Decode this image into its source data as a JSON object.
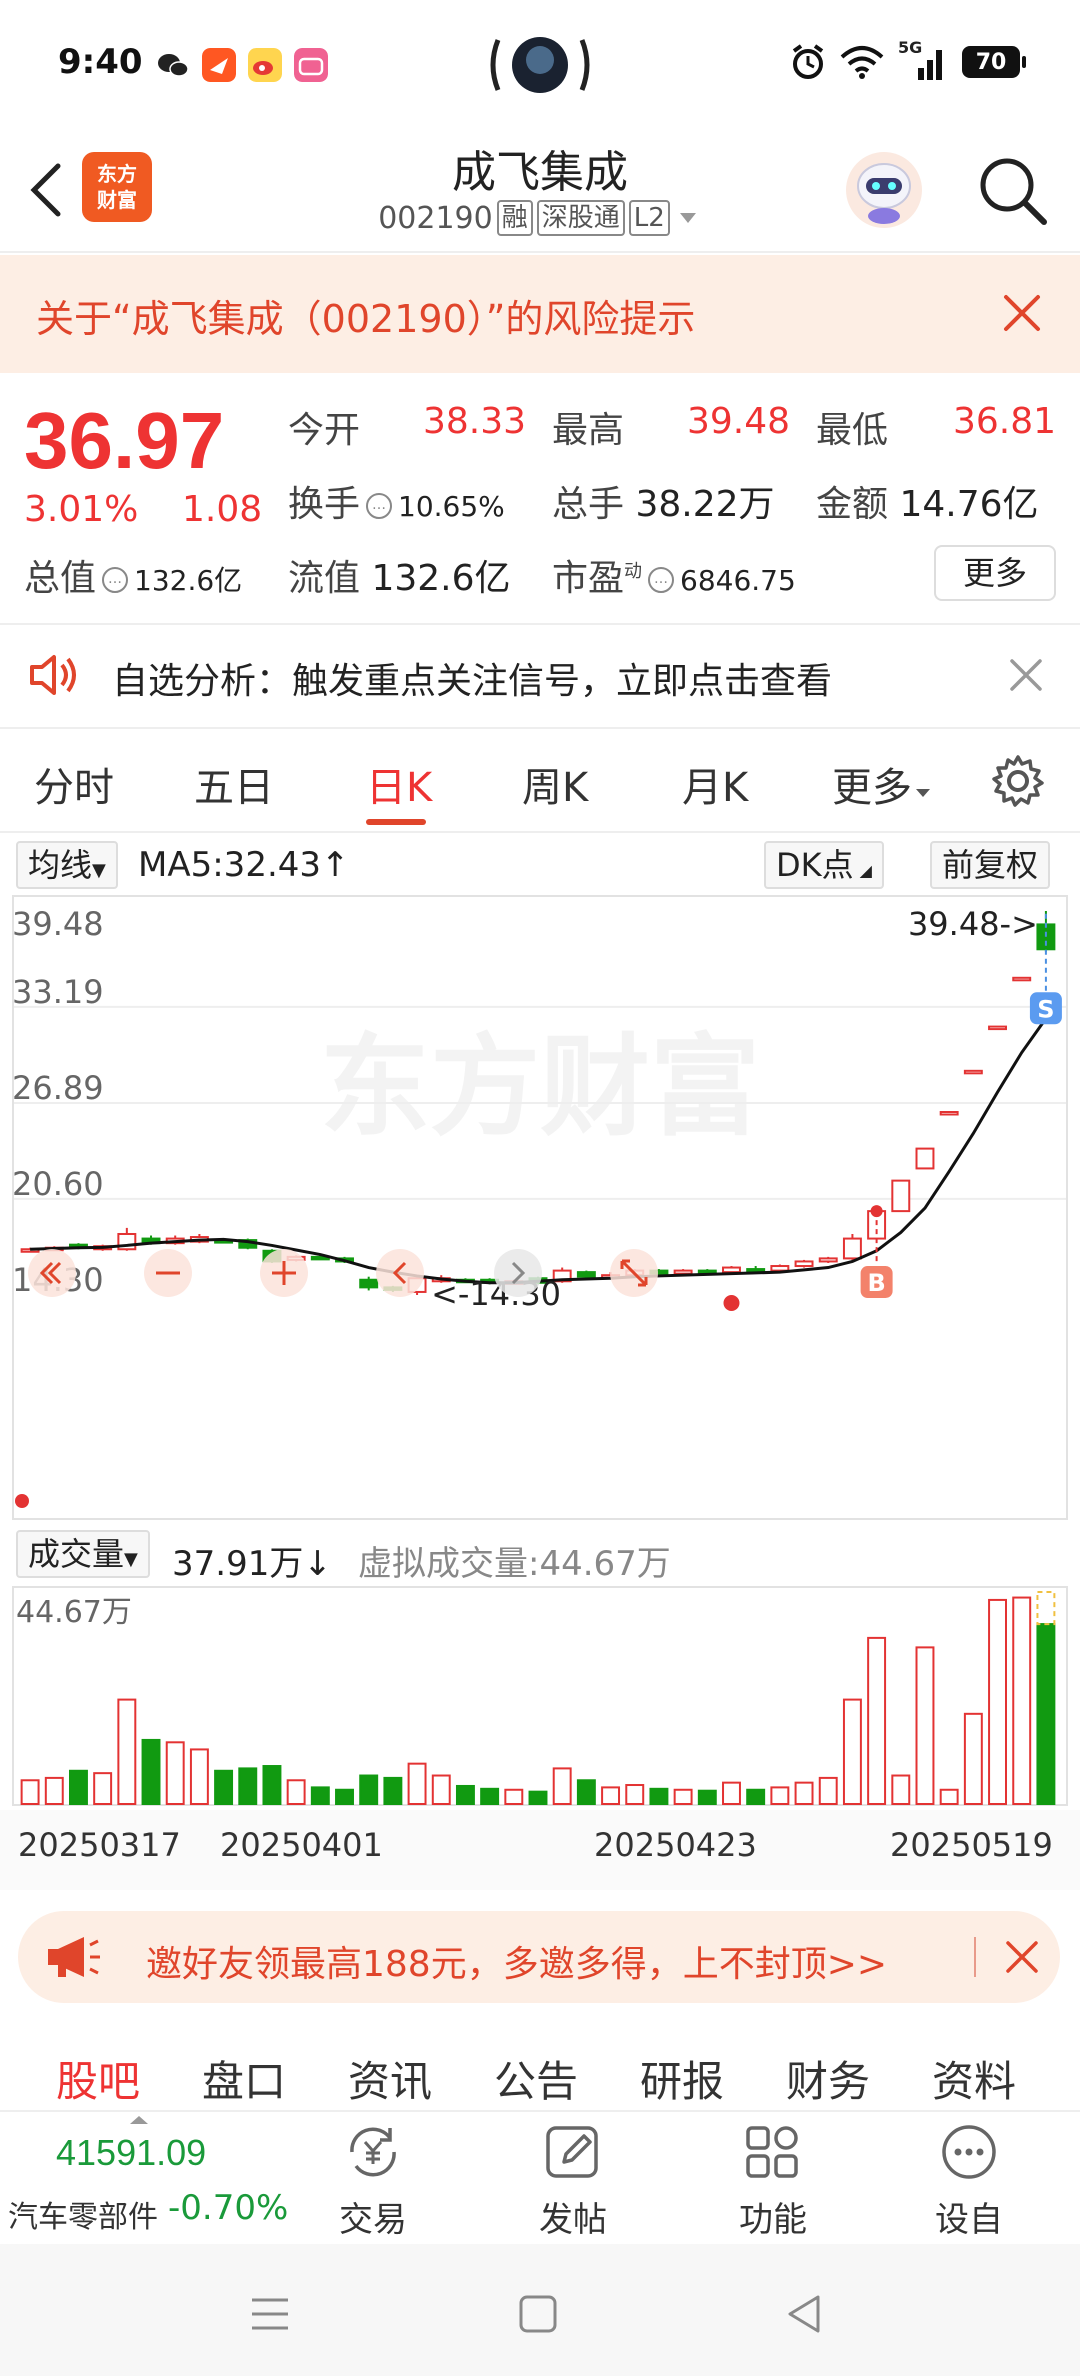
{
  "status": {
    "time": "9:40",
    "network": "5G",
    "battery": "70"
  },
  "header": {
    "logo_line1": "东方",
    "logo_line2": "财富",
    "title": "成飞集成",
    "code": "002190",
    "tag_margin": "融",
    "tag_connect": "深股通",
    "tag_level": "L2"
  },
  "risk": {
    "text": "关于“成飞集成（002190）”的风险提示"
  },
  "quote": {
    "price": "36.97",
    "change_pct": "3.01%",
    "change": "1.08",
    "open_label": "今开",
    "open": "38.33",
    "high_label": "最高",
    "high": "39.48",
    "low_label": "最低",
    "low": "36.81",
    "turnover_label": "换手",
    "turnover": "10.65%",
    "volume_label": "总手",
    "volume": "38.22万",
    "amount_label": "金额",
    "amount": "14.76亿",
    "mktcap_label": "总值",
    "mktcap": "132.6亿",
    "float_label": "流值",
    "float": "132.6亿",
    "pe_label": "市盈",
    "pe_sup": "动",
    "pe": "6846.75",
    "more": "更多"
  },
  "signal": {
    "text": "自选分析：触发重点关注信号，立即点击查看"
  },
  "period_tabs": [
    "分时",
    "五日",
    "日K",
    "周K",
    "月K",
    "更多"
  ],
  "toolbar": {
    "ma_type": "均线",
    "ma_text": "MA5:32.43",
    "ma_arrow": "↑",
    "dk": "DK点",
    "adjust": "前复权"
  },
  "chart_data": {
    "type": "candlestick",
    "y_ticks": [
      "39.48",
      "33.19",
      "26.89",
      "20.60",
      "14.30"
    ],
    "ylim": [
      14.3,
      39.48
    ],
    "high_label": "39.48->",
    "low_label": "<-14.30",
    "buy_marker": "B",
    "sell_marker": "S",
    "watermark": "东方财富",
    "candles": [
      {
        "o": 17.2,
        "c": 17.3,
        "h": 17.4,
        "l": 17.1,
        "v": 5.0
      },
      {
        "o": 17.3,
        "c": 17.4,
        "h": 17.5,
        "l": 17.2,
        "v": 5.5
      },
      {
        "o": 17.6,
        "c": 17.4,
        "h": 17.7,
        "l": 17.3,
        "v": 7.0
      },
      {
        "o": 17.3,
        "c": 17.5,
        "h": 17.6,
        "l": 17.2,
        "v": 6.5
      },
      {
        "o": 17.3,
        "c": 18.3,
        "h": 18.7,
        "l": 17.2,
        "v": 22.0
      },
      {
        "o": 18.0,
        "c": 17.7,
        "h": 18.2,
        "l": 17.6,
        "v": 13.5
      },
      {
        "o": 17.7,
        "c": 18.0,
        "h": 18.2,
        "l": 17.6,
        "v": 13.0
      },
      {
        "o": 17.8,
        "c": 18.1,
        "h": 18.3,
        "l": 17.7,
        "v": 11.5
      },
      {
        "o": 17.9,
        "c": 17.8,
        "h": 18.0,
        "l": 17.7,
        "v": 7.0
      },
      {
        "o": 17.9,
        "c": 17.4,
        "h": 18.0,
        "l": 17.3,
        "v": 7.5
      },
      {
        "o": 17.2,
        "c": 16.5,
        "h": 17.3,
        "l": 16.4,
        "v": 8.0
      },
      {
        "o": 16.6,
        "c": 16.8,
        "h": 16.9,
        "l": 16.5,
        "v": 5.0
      },
      {
        "o": 16.8,
        "c": 16.7,
        "h": 16.9,
        "l": 16.6,
        "v": 3.5
      },
      {
        "o": 16.7,
        "c": 16.5,
        "h": 16.8,
        "l": 16.4,
        "v": 3.0
      },
      {
        "o": 15.3,
        "c": 14.8,
        "h": 15.5,
        "l": 14.6,
        "v": 6.0
      },
      {
        "o": 14.8,
        "c": 14.7,
        "h": 14.9,
        "l": 14.5,
        "v": 5.5
      },
      {
        "o": 14.5,
        "c": 15.4,
        "h": 15.6,
        "l": 14.3,
        "v": 8.5
      },
      {
        "o": 15.2,
        "c": 15.4,
        "h": 15.6,
        "l": 15.1,
        "v": 6.0
      },
      {
        "o": 15.3,
        "c": 15.2,
        "h": 15.4,
        "l": 15.1,
        "v": 3.8
      },
      {
        "o": 15.3,
        "c": 15.1,
        "h": 15.4,
        "l": 15.0,
        "v": 3.2
      },
      {
        "o": 15.1,
        "c": 15.2,
        "h": 15.3,
        "l": 15.0,
        "v": 3.0
      },
      {
        "o": 15.4,
        "c": 15.1,
        "h": 15.5,
        "l": 15.0,
        "v": 2.6
      },
      {
        "o": 15.2,
        "c": 15.9,
        "h": 16.1,
        "l": 15.1,
        "v": 7.5
      },
      {
        "o": 15.8,
        "c": 15.5,
        "h": 15.9,
        "l": 15.4,
        "v": 5.0
      },
      {
        "o": 15.6,
        "c": 15.6,
        "h": 15.8,
        "l": 15.5,
        "v": 3.5
      },
      {
        "o": 15.6,
        "c": 15.9,
        "h": 16.0,
        "l": 15.5,
        "v": 4.0
      },
      {
        "o": 15.9,
        "c": 15.7,
        "h": 16.0,
        "l": 15.6,
        "v": 3.2
      },
      {
        "o": 15.7,
        "c": 15.9,
        "h": 16.0,
        "l": 15.6,
        "v": 3.0
      },
      {
        "o": 15.9,
        "c": 15.8,
        "h": 16.0,
        "l": 15.7,
        "v": 2.8
      },
      {
        "o": 15.8,
        "c": 16.1,
        "h": 16.2,
        "l": 15.7,
        "v": 4.5
      },
      {
        "o": 16.0,
        "c": 15.9,
        "h": 16.2,
        "l": 15.8,
        "v": 3.0
      },
      {
        "o": 15.9,
        "c": 16.2,
        "h": 16.3,
        "l": 15.8,
        "v": 3.5
      },
      {
        "o": 16.2,
        "c": 16.5,
        "h": 16.6,
        "l": 16.1,
        "v": 4.5
      },
      {
        "o": 16.5,
        "c": 16.7,
        "h": 16.8,
        "l": 16.4,
        "v": 5.5
      },
      {
        "o": 16.7,
        "c": 18.0,
        "h": 18.3,
        "l": 16.6,
        "v": 22.0
      },
      {
        "o": 18.0,
        "c": 19.8,
        "h": 19.8,
        "l": 18.0,
        "v": 35.0
      },
      {
        "o": 19.8,
        "c": 21.8,
        "h": 21.8,
        "l": 19.8,
        "v": 6.0
      },
      {
        "o": 22.6,
        "c": 23.9,
        "h": 23.9,
        "l": 22.6,
        "v": 33.0
      },
      {
        "o": 26.3,
        "c": 26.3,
        "h": 26.3,
        "l": 26.3,
        "v": 3.0
      },
      {
        "o": 29.0,
        "c": 29.0,
        "h": 29.0,
        "l": 29.0,
        "v": 19.0
      },
      {
        "o": 31.8,
        "c": 31.9,
        "h": 31.9,
        "l": 31.8,
        "v": 43.0
      },
      {
        "o": 35.1,
        "c": 35.1,
        "h": 35.1,
        "l": 35.1,
        "v": 43.5
      },
      {
        "o": 38.6,
        "c": 36.97,
        "h": 39.48,
        "l": 36.81,
        "v": 37.91
      }
    ],
    "ma5": [
      17.3,
      17.35,
      17.4,
      17.42,
      17.55,
      17.7,
      17.8,
      17.9,
      17.95,
      17.8,
      17.55,
      17.25,
      16.95,
      16.55,
      16.1,
      15.8,
      15.55,
      15.35,
      15.2,
      15.1,
      15.1,
      15.2,
      15.3,
      15.35,
      15.4,
      15.5,
      15.55,
      15.6,
      15.65,
      15.7,
      15.75,
      15.8,
      15.95,
      16.1,
      16.5,
      17.2,
      18.4,
      20.0,
      22.4,
      24.9,
      27.6,
      30.2,
      32.43
    ]
  },
  "volume": {
    "label": "成交量",
    "value": "37.91万",
    "arrow": "↓",
    "virtual": "虚拟成交量:44.67万",
    "max_label": "44.67万",
    "dates": [
      "20250317",
      "20250401",
      "20250423",
      "20250519"
    ]
  },
  "promo": {
    "text": "邀好友领最高188元，多邀多得，上不封顶>>"
  },
  "info_tabs": [
    "股吧",
    "盘口",
    "资讯",
    "公告",
    "研报",
    "财务",
    "资料"
  ],
  "bottom": {
    "index_value": "41591.09",
    "index_name": "汽车零部件",
    "index_change": "-0.70%",
    "trade": "交易",
    "post": "发帖",
    "function": "功能",
    "add_watch": "设自选"
  },
  "colors": {
    "up": "#e33333",
    "down": "#119a11",
    "accent": "#e0452b"
  }
}
